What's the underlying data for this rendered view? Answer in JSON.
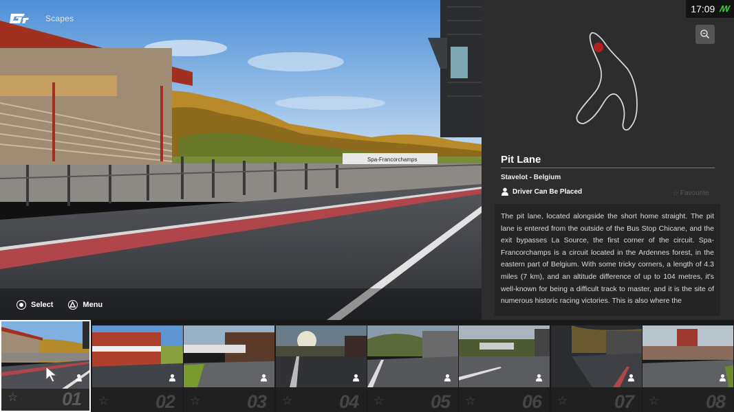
{
  "app": {
    "title": "Scapes"
  },
  "clock": {
    "time": "17:09",
    "signal_icon": "network-signal-icon"
  },
  "controls": [
    {
      "icon": "circle-button-icon",
      "label": "Select"
    },
    {
      "icon": "triangle-button-icon",
      "label": "Menu"
    }
  ],
  "location": {
    "name": "Pit Lane",
    "place": "Stavelot - Belgium",
    "driver_label": "Driver Can Be Placed",
    "favourite_label": "Favourite",
    "description": "The pit lane, located alongside the short home straight. The pit lane is entered from the outside of the Bus Stop Chicane, and the exit bypasses La Source, the first corner of the circuit. Spa-Francorchamps is a circuit located in the Ardennes forest, in the eastern part of Belgium. With some tricky corners, a length of 4.3 miles (7 km), and an altitude difference of up to 104 metres, it's well-known for being a difficult track to master, and it is the site of numerous historic racing victories. This is also where the"
  },
  "scene_sign": "Spa-Francorchamps",
  "thumbnails": [
    {
      "num": "01",
      "selected": true
    },
    {
      "num": "02",
      "selected": false
    },
    {
      "num": "03",
      "selected": false
    },
    {
      "num": "04",
      "selected": false
    },
    {
      "num": "05",
      "selected": false
    },
    {
      "num": "06",
      "selected": false
    },
    {
      "num": "07",
      "selected": false
    },
    {
      "num": "08",
      "selected": false
    }
  ],
  "colors": {
    "panel": "#2d2d2d",
    "accent_red": "#c8262a",
    "signal_green": "#3ccc3c"
  }
}
